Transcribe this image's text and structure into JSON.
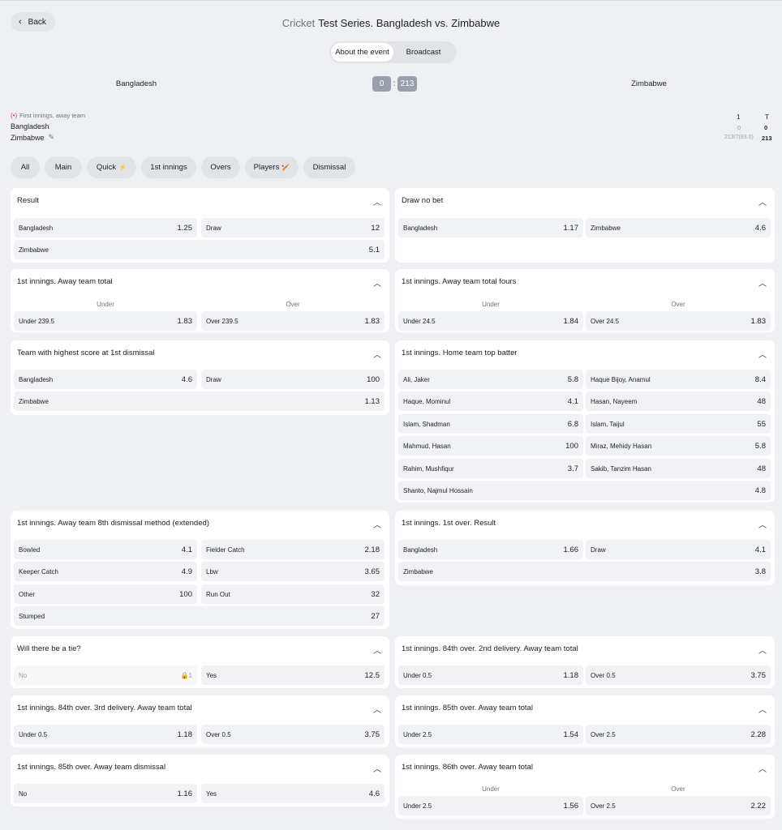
{
  "nav": {
    "back_label": "Back"
  },
  "header": {
    "sport": "Cricket",
    "title": "Test Series. Bangladesh vs. Zimbabwe"
  },
  "tabs": [
    {
      "label": "About the event"
    },
    {
      "label": "Broadcast"
    }
  ],
  "match": {
    "home_team": "Bangladesh",
    "away_team": "Zimbabwe",
    "score_home": "0",
    "score_away": "213",
    "status": "First innings, away team",
    "scoreboard": {
      "col1": "1",
      "colT": "T",
      "team1": "Bangladesh",
      "team1_inn": "0",
      "team1_total": "0",
      "team2": "Zimbabwe",
      "team2_inn": "213/7(83.0)",
      "team2_total": "213"
    }
  },
  "filters": [
    {
      "label": "All"
    },
    {
      "label": "Main"
    },
    {
      "label": "Quick"
    },
    {
      "label": "1st innings"
    },
    {
      "label": "Overs"
    },
    {
      "label": "Players"
    },
    {
      "label": "Dismissal"
    }
  ],
  "colors": {
    "accent": "#e0336a",
    "background": "#eff0f3",
    "cell": "#f1f2f5"
  },
  "markets": [
    {
      "title": "Result",
      "cells": [
        {
          "label": "Bangladesh",
          "odd": "1.25"
        },
        {
          "label": "Draw",
          "odd": "12"
        },
        {
          "label": "Zimbabwe",
          "odd": "5.1"
        }
      ]
    },
    {
      "title": "Draw no bet",
      "cells": [
        {
          "label": "Bangladesh",
          "odd": "1.17"
        },
        {
          "label": "Zimbabwe",
          "odd": "4.6"
        }
      ]
    },
    {
      "title": "1st innings. Away team total",
      "col_a": "Under",
      "col_b": "Over",
      "cells": [
        {
          "label": "Under 239.5",
          "odd": "1.83"
        },
        {
          "label": "Over 239.5",
          "odd": "1.83"
        }
      ]
    },
    {
      "title": "1st innings. Away team total fours",
      "col_a": "Under",
      "col_b": "Over",
      "cells": [
        {
          "label": "Under 24.5",
          "odd": "1.84"
        },
        {
          "label": "Over 24.5",
          "odd": "1.83"
        }
      ]
    },
    {
      "title": "Team with highest score at 1st dismissal",
      "cells": [
        {
          "label": "Bangladesh",
          "odd": "4.6"
        },
        {
          "label": "Draw",
          "odd": "100"
        },
        {
          "label": "Zimbabwe",
          "odd": "1.13"
        }
      ]
    },
    {
      "title": "1st innings. Home team top batter",
      "cells": [
        {
          "label": "Ali, Jaker",
          "odd": "5.8"
        },
        {
          "label": "Haque Bijoy, Anamul",
          "odd": "8.4"
        },
        {
          "label": "Haque, Mominul",
          "odd": "4.1"
        },
        {
          "label": "Hasan, Nayeem",
          "odd": "48"
        },
        {
          "label": "Islam, Shadman",
          "odd": "6.8"
        },
        {
          "label": "Islam, Taijul",
          "odd": "55"
        },
        {
          "label": "Mahmud, Hasan",
          "odd": "100"
        },
        {
          "label": "Miraz, Mehidy Hasan",
          "odd": "5.8"
        },
        {
          "label": "Rahim, Mushfiqur",
          "odd": "3.7"
        },
        {
          "label": "Sakib, Tanzim Hasan",
          "odd": "48"
        },
        {
          "label": "Shanto, Najmul Hossain",
          "odd": "4.8"
        }
      ]
    },
    {
      "title": "1st innings. Away team 8th dismissal method (extended)",
      "cells": [
        {
          "label": "Bowled",
          "odd": "4.1"
        },
        {
          "label": "Fielder Catch",
          "odd": "2.18"
        },
        {
          "label": "Keeper Catch",
          "odd": "4.9"
        },
        {
          "label": "Lbw",
          "odd": "3.65"
        },
        {
          "label": "Other",
          "odd": "100"
        },
        {
          "label": "Run Out",
          "odd": "32"
        },
        {
          "label": "Stumped",
          "odd": "27"
        }
      ]
    },
    {
      "title": "1st innings. 1st over. Result",
      "cells": [
        {
          "label": "Bangladesh",
          "odd": "1.66"
        },
        {
          "label": "Draw",
          "odd": "4.1"
        },
        {
          "label": "Zimbabwe",
          "odd": "3.8"
        }
      ]
    },
    {
      "title": "Will there be a tie?",
      "cells": [
        {
          "label": "No",
          "odd": "1",
          "locked": true
        },
        {
          "label": "Yes",
          "odd": "12.5"
        }
      ]
    },
    {
      "title": "1st innings. 84th over. 2nd delivery. Away team total",
      "cells": [
        {
          "label": "Under 0.5",
          "odd": "1.18"
        },
        {
          "label": "Over 0.5",
          "odd": "3.75"
        }
      ]
    },
    {
      "title": "1st innings. 84th over. 3rd delivery. Away team total",
      "cells": [
        {
          "label": "Under 0.5",
          "odd": "1.18"
        },
        {
          "label": "Over 0.5",
          "odd": "3.75"
        }
      ]
    },
    {
      "title": "1st innings. 85th over. Away team total",
      "cells": [
        {
          "label": "Under 2.5",
          "odd": "1.54"
        },
        {
          "label": "Over 2.5",
          "odd": "2.28"
        }
      ]
    },
    {
      "title": "1st innings. 85th over. Away team dismissal",
      "cells": [
        {
          "label": "No",
          "odd": "1.16"
        },
        {
          "label": "Yes",
          "odd": "4.6"
        }
      ]
    },
    {
      "title": "1st innings. 86th over. Away team total",
      "col_a": "Under",
      "col_b": "Over",
      "cells": [
        {
          "label": "Under 2.5",
          "odd": "1.56"
        },
        {
          "label": "Over 2.5",
          "odd": "2.22"
        }
      ]
    }
  ]
}
